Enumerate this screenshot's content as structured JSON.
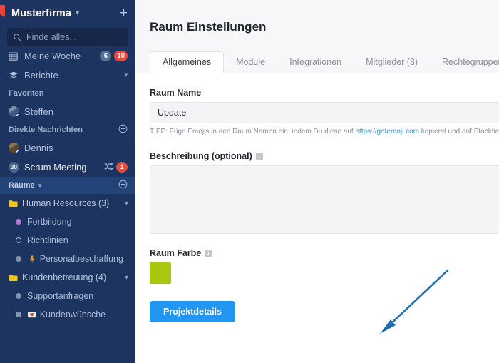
{
  "sidebar": {
    "workspace": {
      "name": "Musterfirma",
      "caret_icon": "chevron-down-icon",
      "add_icon": "plus-icon",
      "flag_icon": "bookmark-flag-icon"
    },
    "search": {
      "placeholder": "Finde alles...",
      "value": "",
      "icon": "search-icon"
    },
    "nav": [
      {
        "label": "Meine Woche",
        "icon": "calendar-icon",
        "badges": [
          {
            "text": "6",
            "color": "#5a7196"
          },
          {
            "text": "10",
            "color": "#e8483e"
          }
        ]
      },
      {
        "label": "Berichte",
        "icon": "layers-icon",
        "caret": "caret-down-icon"
      }
    ],
    "favorites": {
      "title": "Favoriten",
      "items": [
        {
          "label": "Steffen",
          "avatar": "user-avatar",
          "status": "offline"
        }
      ]
    },
    "direct_messages": {
      "title": "Direkte Nachrichten",
      "add_icon": "plus-circle-icon",
      "items": [
        {
          "label": "Dennis",
          "avatar": "user-avatar",
          "status": "offline",
          "badge": ""
        },
        {
          "label": "Scrum Meeting",
          "avatar": "30",
          "shuffle_icon": "shuffle-icon",
          "badge": "1",
          "badge_color": "#e8483e"
        }
      ]
    },
    "rooms": {
      "title": "Räume",
      "caret": "caret-down-icon",
      "add_icon": "plus-circle-icon",
      "items": [
        {
          "label": "Human Resources (3)",
          "type": "folder",
          "color": "#f5c518",
          "chevron": "chevron-down-icon"
        },
        {
          "label": "Fortbildung",
          "type": "room",
          "dot": "#b573d6",
          "indent": true
        },
        {
          "label": "Richtlinien",
          "type": "room",
          "dot": "ring",
          "indent": true
        },
        {
          "label": "Personalbeschaffung",
          "type": "room",
          "dot": "#8494ad",
          "emoji": "🧍",
          "indent": true
        },
        {
          "label": "Kundenbetreuung (4)",
          "type": "folder",
          "color": "#f5c518",
          "chevron": "chevron-down-icon"
        },
        {
          "label": "Supportanfragen",
          "type": "room",
          "dot": "#8494ad",
          "indent": true
        },
        {
          "label": "Kundenwünsche",
          "type": "room",
          "dot": "#8494ad",
          "emoji": "💌",
          "indent": true
        }
      ]
    }
  },
  "main": {
    "title": "Raum Einstellungen",
    "tabs": [
      {
        "label": "Allgemeines",
        "active": true
      },
      {
        "label": "Module",
        "active": false
      },
      {
        "label": "Integrationen",
        "active": false
      },
      {
        "label": "Mitglieder (3)",
        "active": false
      },
      {
        "label": "Rechtegruppen",
        "active": false
      }
    ],
    "form": {
      "room_name_label": "Raum Name",
      "room_name_value": "Update",
      "room_name_placeholder": "Raum Name",
      "tip_prefix": "TIPP: Füge Emojis in den Raum Namen ein, indem Du diese auf ",
      "tip_link": "https://getemoji.com",
      "tip_suffix": " kopierst und auf Stackfield einfügst",
      "description_label": "Beschreibung (optional)",
      "description_value": "",
      "description_placeholder": "",
      "description_info_icon": "info-icon",
      "color_label": "Raum Farbe",
      "color_info_icon": "info-icon",
      "color_value": "#a8c70f",
      "submit_label": "Projektdetails"
    }
  },
  "annotation": {
    "arrow_icon": "arrow-pointing-down-left-icon",
    "color": "#2171b5"
  }
}
